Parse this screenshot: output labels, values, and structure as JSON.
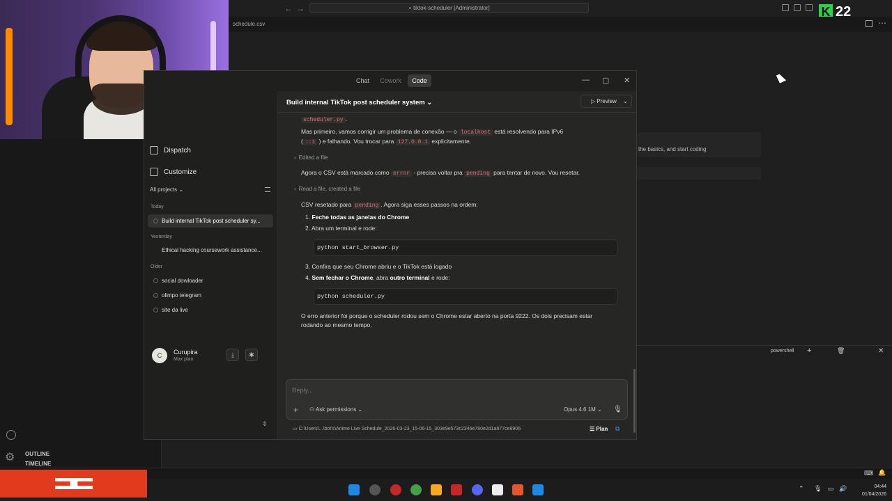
{
  "vscode": {
    "title_search": "tiktok-scheduler [Administrator]",
    "tab": "schedule.csv",
    "counter": "22",
    "bg_hint": "the basics, and start coding",
    "outline": "OUTLINE",
    "timeline": "TIMELINE",
    "terminal": "powershell"
  },
  "claude": {
    "modes": [
      "Chat",
      "Cowork",
      "Code"
    ],
    "active_mode": "Code",
    "sidebar": {
      "nav": [
        "Dispatch",
        "Customize"
      ],
      "all_projects": "All projects",
      "groups": {
        "today": "Today",
        "yesterday": "Yesterday",
        "older": "Older"
      },
      "conversations": {
        "today": [
          "Build internal TikTok post scheduler sy..."
        ],
        "yesterday": [
          "Ethical hacking coursework assistance..."
        ],
        "older": [
          "social dowloader",
          "olimpo telegram",
          "site da live"
        ]
      },
      "user": {
        "initial": "C",
        "name": "Curupira",
        "plan": "Max plan"
      }
    },
    "header": {
      "title": "Build internal TikTok post scheduler system",
      "preview": "Preview"
    },
    "chat": {
      "frag_code": "scheduler.py",
      "msg1_a": "Mas primeiro, vamos corrigir um problema de conexão — o",
      "msg1_code1": "localhost",
      "msg1_b": "está resolvendo para IPv6",
      "msg1_code2": "::1",
      "msg1_c": ") e falhando. Vou trocar para",
      "msg1_code3": "127.0.0.1",
      "msg1_d": "explicitamente.",
      "tool1": "Edited a file",
      "msg2_a": "Agora o CSV está marcado como",
      "msg2_code1": "error",
      "msg2_b": "- precisa voltar pra",
      "msg2_code2": "pending",
      "msg2_c": "para tentar de novo. Vou resetar.",
      "tool2": "Read a file, created a file",
      "msg3_a": "CSV resetado para",
      "msg3_code": "pending",
      "msg3_b": ". Agora siga esses passos na ordem:",
      "step1": "Feche todas as janelas do Chrome",
      "step2": "Abra um terminal e rode:",
      "code1": "python start_browser.py",
      "step3": "Confira que seu Chrome abriu e o TikTok está logado",
      "step4_b1": "Sem fechar o Chrome",
      "step4_t1": ", abra",
      "step4_b2": "outro terminal",
      "step4_t2": "e rode:",
      "code2": "python scheduler.py",
      "msg4": "O erro anterior foi porque o scheduler rodou sem o Chrome estar aberto na porta 9222. Os dois precisam estar rodando ao mesmo tempo."
    },
    "reply": {
      "placeholder": "Reply...",
      "permissions": "Ask permissions",
      "model": "Opus 4.6 1M",
      "path": "C:\\Users\\...\\bot's\\Anime Live Schedule_2026-03-23_15-06-15_303e9e573c2346e780e2d1a677ce8906",
      "plan": "Plan"
    }
  },
  "taskbar": {
    "time": "04:44",
    "date": "01/04/2026"
  }
}
